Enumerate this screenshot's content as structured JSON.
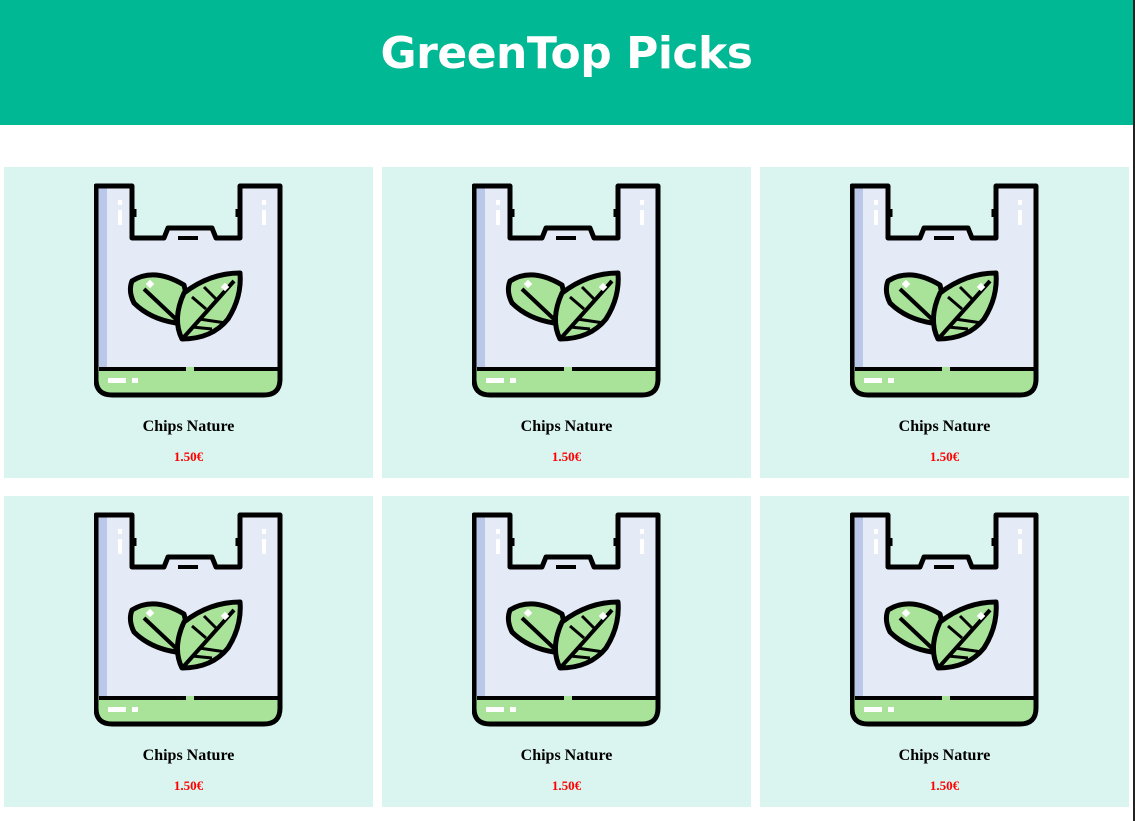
{
  "header": {
    "title": "GreenTop Picks",
    "background_color": "#00b894",
    "title_color": "#ffffff"
  },
  "products": [
    {
      "name": "Chips Nature",
      "price": "1.50€",
      "icon": "eco-bag-leaf-icon"
    },
    {
      "name": "Chips Nature",
      "price": "1.50€",
      "icon": "eco-bag-leaf-icon"
    },
    {
      "name": "Chips Nature",
      "price": "1.50€",
      "icon": "eco-bag-leaf-icon"
    },
    {
      "name": "Chips Nature",
      "price": "1.50€",
      "icon": "eco-bag-leaf-icon"
    },
    {
      "name": "Chips Nature",
      "price": "1.50€",
      "icon": "eco-bag-leaf-icon"
    },
    {
      "name": "Chips Nature",
      "price": "1.50€",
      "icon": "eco-bag-leaf-icon"
    }
  ],
  "colors": {
    "card_background": "#daf4ef",
    "price": "#ff0000",
    "bag_fill": "#e4eaf6",
    "bag_shade": "#b9c8e8",
    "leaf_fill": "#a9e39a",
    "outline": "#000000"
  }
}
